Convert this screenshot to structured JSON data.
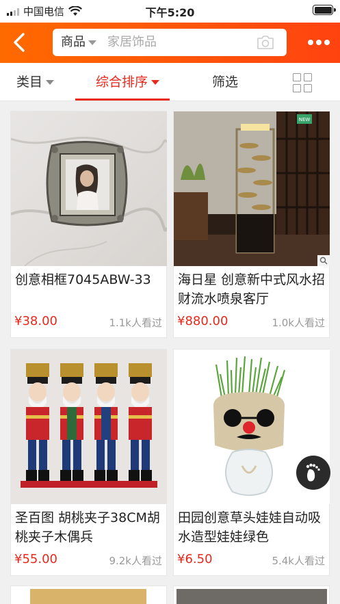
{
  "status_bar": {
    "carrier": "中国电信",
    "time": "下午5:20"
  },
  "header": {
    "search_category": "商品",
    "search_placeholder": "家居饰品",
    "back_icon": "chevron-left-icon",
    "camera_icon": "camera-icon",
    "more_icon": "more-dots-icon"
  },
  "tabs": [
    {
      "label": "类目"
    },
    {
      "label": "综合排序",
      "active": true
    },
    {
      "label": "筛选"
    }
  ],
  "products": [
    {
      "title": "创意相框7045ABW-33",
      "price": "¥38.00",
      "views": "1.1k人看过"
    },
    {
      "title": "海日星 创意新中式风水招财流水喷泉客厅",
      "price": "¥880.00",
      "views": "1.0k人看过",
      "badge": "NEW"
    },
    {
      "title": "圣百图 胡桃夹子38CM胡桃夹子木偶兵",
      "price": "¥55.00",
      "views": "9.2k人看过"
    },
    {
      "title": "田园创意草头娃娃自动吸水造型娃娃绿色",
      "price": "¥6.50",
      "views": "5.4k人看过"
    }
  ],
  "colors": {
    "header_start": "#ff6a00",
    "header_end": "#ff4310",
    "accent_red": "#e8291c"
  }
}
